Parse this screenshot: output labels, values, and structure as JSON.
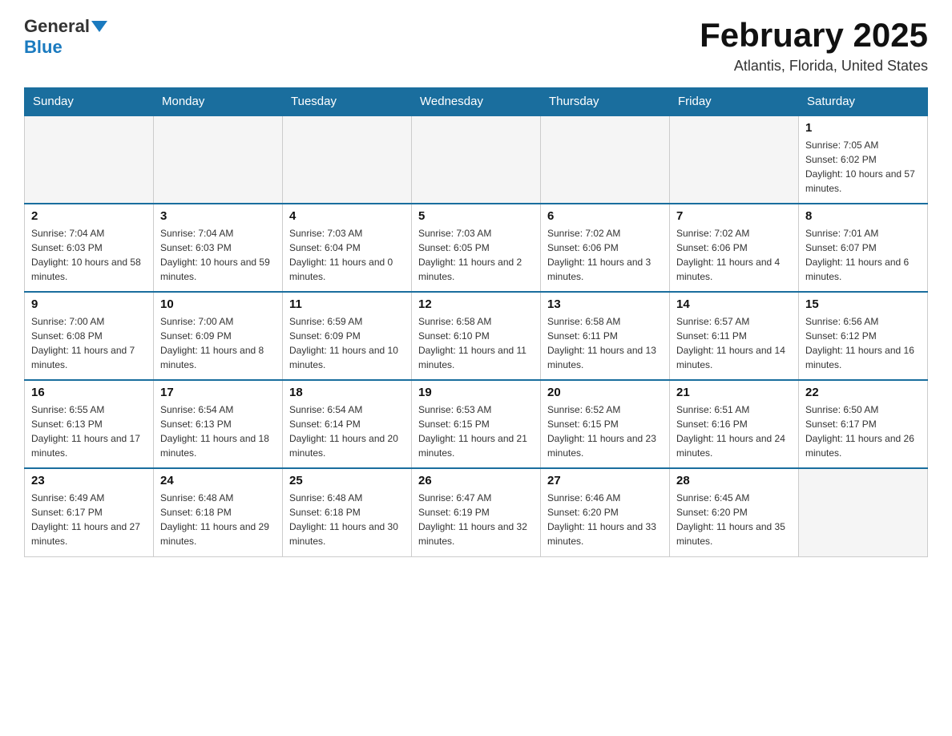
{
  "header": {
    "logo_general": "General",
    "logo_blue": "Blue",
    "title": "February 2025",
    "location": "Atlantis, Florida, United States"
  },
  "days_of_week": [
    "Sunday",
    "Monday",
    "Tuesday",
    "Wednesday",
    "Thursday",
    "Friday",
    "Saturday"
  ],
  "weeks": [
    [
      {
        "day": "",
        "empty": true
      },
      {
        "day": "",
        "empty": true
      },
      {
        "day": "",
        "empty": true
      },
      {
        "day": "",
        "empty": true
      },
      {
        "day": "",
        "empty": true
      },
      {
        "day": "",
        "empty": true
      },
      {
        "day": "1",
        "sunrise": "7:05 AM",
        "sunset": "6:02 PM",
        "daylight": "10 hours and 57 minutes."
      }
    ],
    [
      {
        "day": "2",
        "sunrise": "7:04 AM",
        "sunset": "6:03 PM",
        "daylight": "10 hours and 58 minutes."
      },
      {
        "day": "3",
        "sunrise": "7:04 AM",
        "sunset": "6:03 PM",
        "daylight": "10 hours and 59 minutes."
      },
      {
        "day": "4",
        "sunrise": "7:03 AM",
        "sunset": "6:04 PM",
        "daylight": "11 hours and 0 minutes."
      },
      {
        "day": "5",
        "sunrise": "7:03 AM",
        "sunset": "6:05 PM",
        "daylight": "11 hours and 2 minutes."
      },
      {
        "day": "6",
        "sunrise": "7:02 AM",
        "sunset": "6:06 PM",
        "daylight": "11 hours and 3 minutes."
      },
      {
        "day": "7",
        "sunrise": "7:02 AM",
        "sunset": "6:06 PM",
        "daylight": "11 hours and 4 minutes."
      },
      {
        "day": "8",
        "sunrise": "7:01 AM",
        "sunset": "6:07 PM",
        "daylight": "11 hours and 6 minutes."
      }
    ],
    [
      {
        "day": "9",
        "sunrise": "7:00 AM",
        "sunset": "6:08 PM",
        "daylight": "11 hours and 7 minutes."
      },
      {
        "day": "10",
        "sunrise": "7:00 AM",
        "sunset": "6:09 PM",
        "daylight": "11 hours and 8 minutes."
      },
      {
        "day": "11",
        "sunrise": "6:59 AM",
        "sunset": "6:09 PM",
        "daylight": "11 hours and 10 minutes."
      },
      {
        "day": "12",
        "sunrise": "6:58 AM",
        "sunset": "6:10 PM",
        "daylight": "11 hours and 11 minutes."
      },
      {
        "day": "13",
        "sunrise": "6:58 AM",
        "sunset": "6:11 PM",
        "daylight": "11 hours and 13 minutes."
      },
      {
        "day": "14",
        "sunrise": "6:57 AM",
        "sunset": "6:11 PM",
        "daylight": "11 hours and 14 minutes."
      },
      {
        "day": "15",
        "sunrise": "6:56 AM",
        "sunset": "6:12 PM",
        "daylight": "11 hours and 16 minutes."
      }
    ],
    [
      {
        "day": "16",
        "sunrise": "6:55 AM",
        "sunset": "6:13 PM",
        "daylight": "11 hours and 17 minutes."
      },
      {
        "day": "17",
        "sunrise": "6:54 AM",
        "sunset": "6:13 PM",
        "daylight": "11 hours and 18 minutes."
      },
      {
        "day": "18",
        "sunrise": "6:54 AM",
        "sunset": "6:14 PM",
        "daylight": "11 hours and 20 minutes."
      },
      {
        "day": "19",
        "sunrise": "6:53 AM",
        "sunset": "6:15 PM",
        "daylight": "11 hours and 21 minutes."
      },
      {
        "day": "20",
        "sunrise": "6:52 AM",
        "sunset": "6:15 PM",
        "daylight": "11 hours and 23 minutes."
      },
      {
        "day": "21",
        "sunrise": "6:51 AM",
        "sunset": "6:16 PM",
        "daylight": "11 hours and 24 minutes."
      },
      {
        "day": "22",
        "sunrise": "6:50 AM",
        "sunset": "6:17 PM",
        "daylight": "11 hours and 26 minutes."
      }
    ],
    [
      {
        "day": "23",
        "sunrise": "6:49 AM",
        "sunset": "6:17 PM",
        "daylight": "11 hours and 27 minutes."
      },
      {
        "day": "24",
        "sunrise": "6:48 AM",
        "sunset": "6:18 PM",
        "daylight": "11 hours and 29 minutes."
      },
      {
        "day": "25",
        "sunrise": "6:48 AM",
        "sunset": "6:18 PM",
        "daylight": "11 hours and 30 minutes."
      },
      {
        "day": "26",
        "sunrise": "6:47 AM",
        "sunset": "6:19 PM",
        "daylight": "11 hours and 32 minutes."
      },
      {
        "day": "27",
        "sunrise": "6:46 AM",
        "sunset": "6:20 PM",
        "daylight": "11 hours and 33 minutes."
      },
      {
        "day": "28",
        "sunrise": "6:45 AM",
        "sunset": "6:20 PM",
        "daylight": "11 hours and 35 minutes."
      },
      {
        "day": "",
        "empty": true
      }
    ]
  ]
}
